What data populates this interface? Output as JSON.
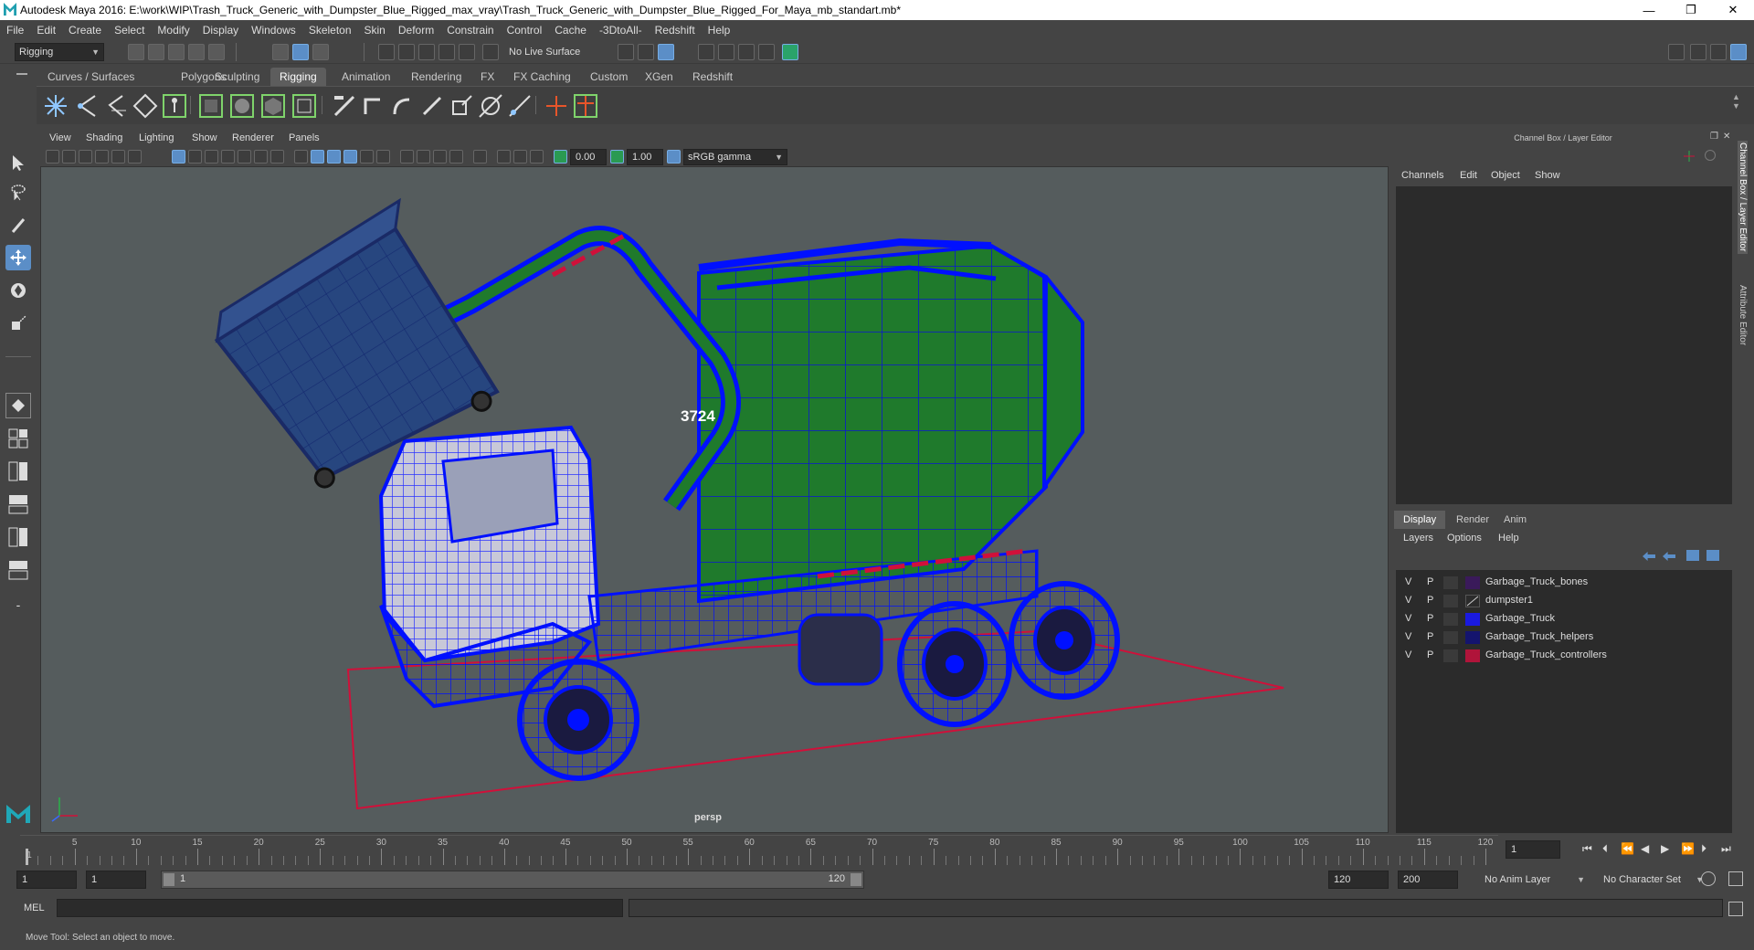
{
  "window": {
    "title": "Autodesk Maya 2016: E:\\work\\WIP\\Trash_Truck_Generic_with_Dumpster_Blue_Rigged_max_vray\\Trash_Truck_Generic_with_Dumpster_Blue_Rigged_For_Maya_mb_standart.mb*",
    "minimize": "—",
    "restore": "❐",
    "close": "✕"
  },
  "menubar": [
    "File",
    "Edit",
    "Create",
    "Select",
    "Modify",
    "Display",
    "Windows",
    "Skeleton",
    "Skin",
    "Deform",
    "Constrain",
    "Control",
    "Cache",
    "-3DtoAll-",
    "Redshift",
    "Help"
  ],
  "statusline": {
    "menuset": "Rigging",
    "live_surface": "No Live Surface"
  },
  "shelf_tabs": [
    "Curves / Surfaces",
    "Polygons",
    "Sculpting",
    "Rigging",
    "Animation",
    "Rendering",
    "FX",
    "FX Caching",
    "Custom",
    "XGen",
    "Redshift"
  ],
  "shelf_active": "Rigging",
  "viewport": {
    "menu": [
      "View",
      "Shading",
      "Lighting",
      "Show",
      "Renderer",
      "Panels"
    ],
    "exposure": "0.00",
    "gamma": "1.00",
    "colorspace": "sRGB gamma",
    "camera": "persp",
    "truck_number": "3724"
  },
  "right_panel": {
    "title": "Channel Box / Layer Editor",
    "menu": [
      "Channels",
      "Edit",
      "Object",
      "Show"
    ],
    "tabs": [
      "Display",
      "Render",
      "Anim"
    ],
    "active_tab": "Display",
    "layer_menu": [
      "Layers",
      "Options",
      "Help"
    ],
    "layers": [
      {
        "v": "V",
        "p": "P",
        "name": "Garbage_Truck_bones",
        "color": "#3a1a5a"
      },
      {
        "v": "V",
        "p": "P",
        "name": "dumpster1",
        "color": "#2b2b2b"
      },
      {
        "v": "V",
        "p": "P",
        "name": "Garbage_Truck",
        "color": "#1a1ae0"
      },
      {
        "v": "V",
        "p": "P",
        "name": "Garbage_Truck_helpers",
        "color": "#14146e"
      },
      {
        "v": "V",
        "p": "P",
        "name": "Garbage_Truck_controllers",
        "color": "#b0143a"
      }
    ],
    "side_tabs": [
      "Channel Box / Layer Editor",
      "Attribute Editor"
    ]
  },
  "timeline": {
    "ticks": [
      5,
      10,
      15,
      20,
      25,
      30,
      35,
      40,
      45,
      50,
      55,
      60,
      65,
      70,
      75,
      80,
      85,
      90,
      95,
      100,
      105,
      110,
      115,
      120
    ],
    "start_label": "1",
    "current_frame": "1"
  },
  "range": {
    "start": "1",
    "playback_start": "1",
    "slider_start": "1",
    "slider_end": "120",
    "playback_end": "120",
    "end": "200",
    "anim_layer": "No Anim Layer",
    "character_set": "No Character Set"
  },
  "mel": {
    "label": "MEL"
  },
  "helpline": {
    "text": "Move Tool: Select an object to move."
  }
}
